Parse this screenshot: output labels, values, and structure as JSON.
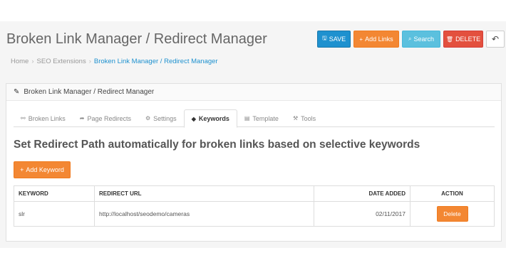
{
  "header": {
    "title": "Broken Link Manager / Redirect Manager",
    "buttons": {
      "save": "SAVE",
      "add_links": "Add Links",
      "search": "Search",
      "delete": "DELETE",
      "back_icon": "reply-icon"
    }
  },
  "breadcrumb": [
    {
      "label": "Home"
    },
    {
      "label": "SEO Extensions"
    },
    {
      "label": "Broken Link Manager / Redirect Manager"
    }
  ],
  "panel": {
    "title": "Broken Link Manager / Redirect Manager",
    "tabs": [
      {
        "label": "Broken Links",
        "icon": "chain-broken-icon"
      },
      {
        "label": "Page Redirects",
        "icon": "share-icon"
      },
      {
        "label": "Settings",
        "icon": "cogs-icon"
      },
      {
        "label": "Keywords",
        "icon": "tags-icon",
        "active": true
      },
      {
        "label": "Template",
        "icon": "card-icon"
      },
      {
        "label": "Tools",
        "icon": "wrench-icon"
      }
    ],
    "section_heading": "Set Redirect Path automatically for broken links based on selective keywords",
    "add_keyword_label": "Add Keyword",
    "table": {
      "headers": [
        "KEYWORD",
        "REDIRECT URL",
        "DATE ADDED",
        "ACTION"
      ],
      "rows": [
        {
          "keyword": "slr",
          "redirect_url": "http://localhost/seodemo/cameras",
          "date_added": "02/11/2017",
          "action": "Delete"
        }
      ]
    }
  },
  "colors": {
    "primary": "#1e91cf",
    "warning": "#f38733",
    "info": "#5bc0de",
    "danger": "#e3503e"
  }
}
